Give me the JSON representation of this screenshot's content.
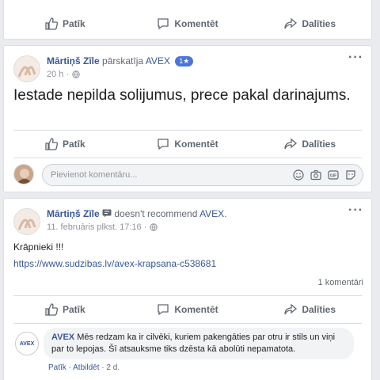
{
  "actions": {
    "like": "Patīk",
    "comment": "Komentēt",
    "share": "Dalīties"
  },
  "post2": {
    "author": "Mārtiņš Zīle",
    "verb": "pārskatīja",
    "page": "AVEX",
    "badge": "1★",
    "time": "20 h ·",
    "text": "Iestade nepilda solijumus, prece pakal darinajums.",
    "comment_placeholder": "Pievienot komentāru..."
  },
  "post3": {
    "author": "Mārtiņš Zīle",
    "verb": "doesn't recommend",
    "page": "AVEX.",
    "time": "11. februāris plkst. 17:16 ·",
    "text": "Krāpnieki !!!",
    "link": "https://www.sudzibas.lv/avex-krapsana-c538681",
    "comment_count": "1 komentāri",
    "reply": {
      "author": "AVEX",
      "text": "Mēs redzam ka ir cilvēki, kuriem pakengāties par otru ir stils un viņi par to lepojas. Šī atsauksme tiks dzēsta kā abolūti nepamatota.",
      "like": "Patīk",
      "answer": "Atbildēt",
      "age": "2 d.",
      "logo": "AVEX"
    }
  },
  "colors": {
    "link": "#385898",
    "badge": "#4a76d9",
    "muted": "#606770"
  }
}
